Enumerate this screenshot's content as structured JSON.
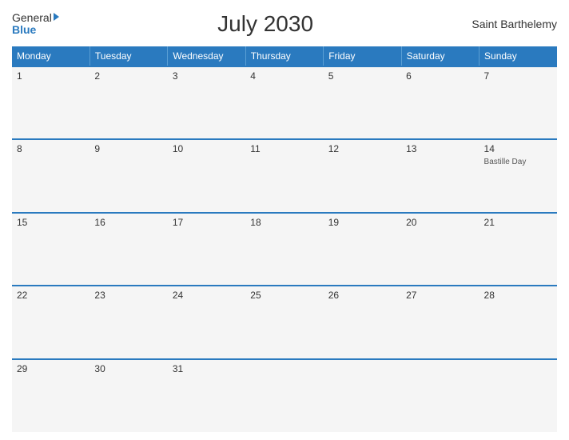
{
  "header": {
    "title": "July 2030",
    "region": "Saint Barthelemy",
    "logo": {
      "general": "General",
      "blue": "Blue"
    }
  },
  "weekdays": [
    "Monday",
    "Tuesday",
    "Wednesday",
    "Thursday",
    "Friday",
    "Saturday",
    "Sunday"
  ],
  "weeks": [
    [
      {
        "day": "1",
        "event": ""
      },
      {
        "day": "2",
        "event": ""
      },
      {
        "day": "3",
        "event": ""
      },
      {
        "day": "4",
        "event": ""
      },
      {
        "day": "5",
        "event": ""
      },
      {
        "day": "6",
        "event": ""
      },
      {
        "day": "7",
        "event": ""
      }
    ],
    [
      {
        "day": "8",
        "event": ""
      },
      {
        "day": "9",
        "event": ""
      },
      {
        "day": "10",
        "event": ""
      },
      {
        "day": "11",
        "event": ""
      },
      {
        "day": "12",
        "event": ""
      },
      {
        "day": "13",
        "event": ""
      },
      {
        "day": "14",
        "event": "Bastille Day"
      }
    ],
    [
      {
        "day": "15",
        "event": ""
      },
      {
        "day": "16",
        "event": ""
      },
      {
        "day": "17",
        "event": ""
      },
      {
        "day": "18",
        "event": ""
      },
      {
        "day": "19",
        "event": ""
      },
      {
        "day": "20",
        "event": ""
      },
      {
        "day": "21",
        "event": ""
      }
    ],
    [
      {
        "day": "22",
        "event": ""
      },
      {
        "day": "23",
        "event": ""
      },
      {
        "day": "24",
        "event": ""
      },
      {
        "day": "25",
        "event": ""
      },
      {
        "day": "26",
        "event": ""
      },
      {
        "day": "27",
        "event": ""
      },
      {
        "day": "28",
        "event": ""
      }
    ],
    [
      {
        "day": "29",
        "event": ""
      },
      {
        "day": "30",
        "event": ""
      },
      {
        "day": "31",
        "event": ""
      },
      {
        "day": "",
        "event": ""
      },
      {
        "day": "",
        "event": ""
      },
      {
        "day": "",
        "event": ""
      },
      {
        "day": "",
        "event": ""
      }
    ]
  ]
}
